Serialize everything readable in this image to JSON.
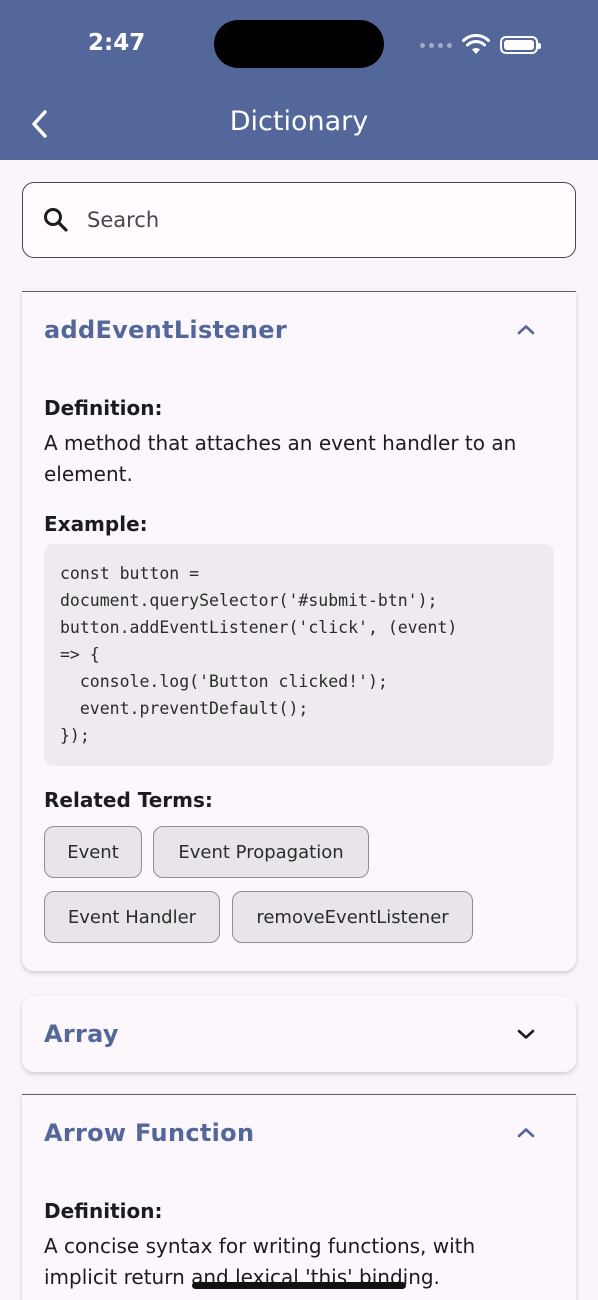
{
  "status": {
    "time": "2:47"
  },
  "header": {
    "title": "Dictionary"
  },
  "search": {
    "placeholder": "Search"
  },
  "entries": [
    {
      "term": "addEventListener",
      "expanded": true,
      "definition_label": "Definition:",
      "definition": "A method that attaches an event handler to an element.",
      "example_label": "Example:",
      "example": "const button =\ndocument.querySelector('#submit-btn');\nbutton.addEventListener('click', (event)\n=> {\n  console.log('Button clicked!');\n  event.preventDefault();\n});",
      "related_label": "Related Terms:",
      "related": [
        "Event",
        "Event Propagation",
        "Event Handler",
        "removeEventListener"
      ]
    },
    {
      "term": "Array",
      "expanded": false
    },
    {
      "term": "Arrow Function",
      "expanded": true,
      "definition_label": "Definition:",
      "definition": "A concise syntax for writing functions, with implicit return and lexical 'this' binding."
    }
  ],
  "colors": {
    "app_bar": "#53679a",
    "accent": "#53679a",
    "background": "#fbf5fb",
    "code_bg": "#eeeaef",
    "chip_bg": "#e8e4ea"
  },
  "icons": [
    "back-arrow-icon",
    "search-icon",
    "chevron-up-icon",
    "chevron-down-icon",
    "wifi-icon",
    "battery-icon"
  ]
}
